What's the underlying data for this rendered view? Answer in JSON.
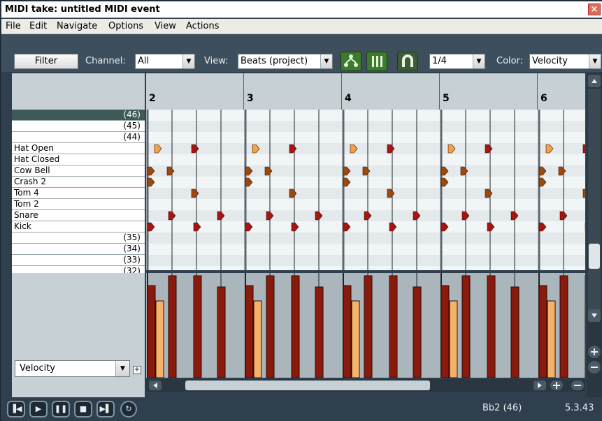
{
  "window": {
    "title": "MIDI take: untitled MIDI event",
    "close_glyph": "×"
  },
  "menu": [
    "File",
    "Edit",
    "Navigate",
    "Options",
    "View",
    "Actions"
  ],
  "toolbar": {
    "filter_label": "Filter",
    "channel_label": "Channel:",
    "channel_value": "All",
    "view_label": "View:",
    "view_value": "Beats (project)",
    "grid_value": "1/4",
    "color_label": "Color:",
    "color_value": "Velocity",
    "icon_buttons": [
      "tree-icon",
      "bars-icon",
      "magnet-icon"
    ]
  },
  "piano_keys": [
    {
      "label": "",
      "num": "(46)",
      "selected": true
    },
    {
      "label": "",
      "num": "(45)",
      "selected": false
    },
    {
      "label": "",
      "num": "(44)",
      "selected": false
    },
    {
      "label": "Hat Open",
      "num": "",
      "selected": false
    },
    {
      "label": "Hat Closed",
      "num": "",
      "selected": false
    },
    {
      "label": "Cow Bell",
      "num": "",
      "selected": false
    },
    {
      "label": "Crash 2",
      "num": "",
      "selected": false
    },
    {
      "label": "Tom 4",
      "num": "",
      "selected": false
    },
    {
      "label": "Tom 2",
      "num": "",
      "selected": false
    },
    {
      "label": "Snare",
      "num": "",
      "selected": false
    },
    {
      "label": "Kick",
      "num": "",
      "selected": false
    },
    {
      "label": "",
      "num": "(35)",
      "selected": false
    },
    {
      "label": "",
      "num": "(34)",
      "selected": false
    },
    {
      "label": "",
      "num": "(33)",
      "selected": false
    },
    {
      "label": "",
      "num": "(32)",
      "selected": false
    }
  ],
  "bars": [
    "2",
    "3",
    "4",
    "5",
    "6"
  ],
  "lane": {
    "label": "Velocity"
  },
  "status": {
    "note": "Bb2 (46)",
    "position": "5.3.43"
  },
  "transport": [
    "skip-back-icon",
    "play-icon",
    "pause-icon",
    "stop-icon",
    "skip-forward-icon",
    "loop-icon"
  ],
  "colors": {
    "note_red": "#a8140f",
    "note_brown": "#9b4a0c",
    "note_orange": "#f2a244",
    "panel": "#2f3f4d"
  }
}
